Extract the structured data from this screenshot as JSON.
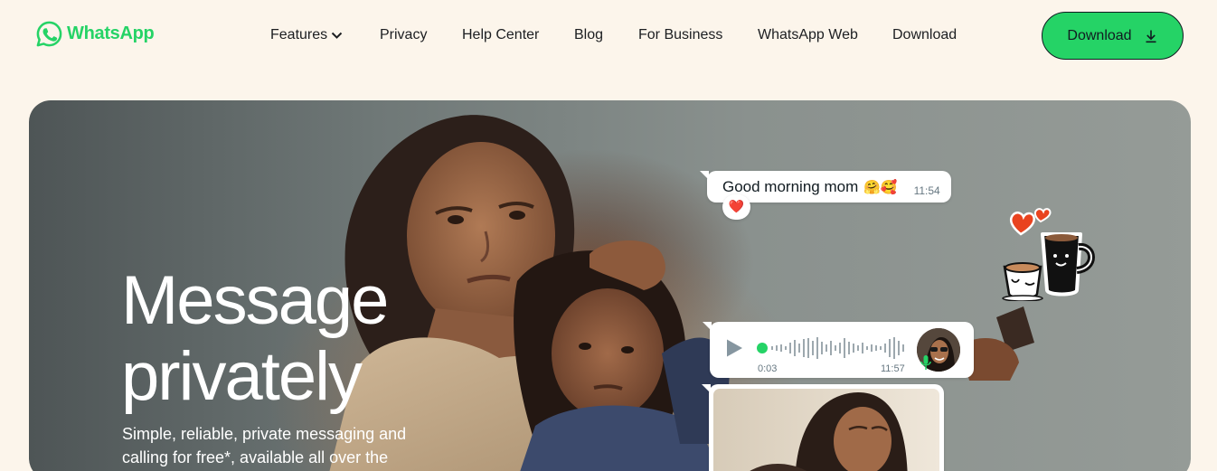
{
  "brand": {
    "name": "WhatsApp",
    "color": "#25D366",
    "logo_icon": "whatsapp-logo-icon"
  },
  "nav": {
    "items": [
      {
        "label": "Features",
        "has_dropdown": true,
        "icon": "chevron-down-icon"
      },
      {
        "label": "Privacy"
      },
      {
        "label": "Help Center"
      },
      {
        "label": "Blog"
      },
      {
        "label": "For Business"
      },
      {
        "label": "WhatsApp Web"
      },
      {
        "label": "Download"
      }
    ]
  },
  "header_button": {
    "label": "Download",
    "icon": "download-arrow-icon",
    "bg_color": "#25D366"
  },
  "hero": {
    "title_line1": "Message",
    "title_line2": "privately",
    "subtitle": "Simple, reliable, private messaging and calling for free*, available all over the",
    "chat": {
      "message_text": "Good morning mom",
      "message_emojis": "🤗🥰",
      "message_time": "11:54",
      "reaction": "❤️",
      "voice_start_time": "0:03",
      "voice_end_time": "11:57",
      "voice_play_icon": "play-icon",
      "voice_mic_icon": "mic-icon",
      "sticker": "coffee-mugs-hearts-sticker"
    }
  },
  "colors": {
    "page_bg": "#FCF5EB",
    "accent": "#25D366",
    "text": "#1C1E21"
  }
}
